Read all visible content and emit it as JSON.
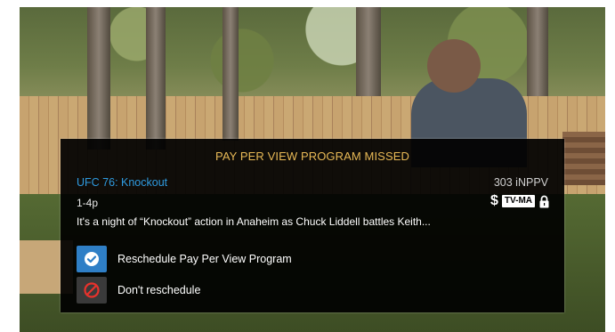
{
  "dialog": {
    "title": "PAY PER VIEW PROGRAM MISSED",
    "program_title": "UFC 76: Knockout",
    "time": "1-4p",
    "channel": "303 iNPPV",
    "price_symbol": "$",
    "rating": "TV-MA",
    "description": "It's a night of “Knockout” action in Anaheim as Chuck Liddell battles Keith...",
    "options": [
      {
        "label": "Reschedule Pay Per View Program",
        "icon": "check-circle-icon",
        "selected": true
      },
      {
        "label": "Don't reschedule",
        "icon": "no-entry-icon",
        "selected": false
      }
    ]
  },
  "colors": {
    "title": "#e8b956",
    "program_title": "#2f9be0",
    "selected_option": "#2f7fc6",
    "cancel_icon": "#e8322c"
  }
}
